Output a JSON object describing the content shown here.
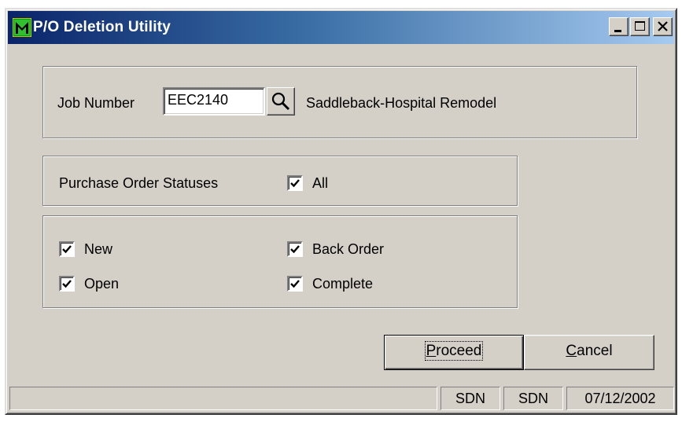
{
  "window": {
    "title": "P/O Deletion Utility",
    "controls": [
      "minimize-icon",
      "maximize-icon",
      "close-icon"
    ]
  },
  "job": {
    "label": "Job Number",
    "value": "EEC2140",
    "description": "Saddleback-Hospital Remodel"
  },
  "statuses": {
    "label": "Purchase Order Statuses",
    "all": {
      "label": "All",
      "checked": true
    },
    "items": [
      {
        "label": "New",
        "checked": true
      },
      {
        "label": "Open",
        "checked": true
      },
      {
        "label": "Back Order",
        "checked": true
      },
      {
        "label": "Complete",
        "checked": true
      }
    ]
  },
  "buttons": {
    "proceed": "Proceed",
    "cancel": "Cancel"
  },
  "statusbar": {
    "panel1": "",
    "panel2": "SDN",
    "panel3": "SDN",
    "panel4": "07/12/2002"
  }
}
